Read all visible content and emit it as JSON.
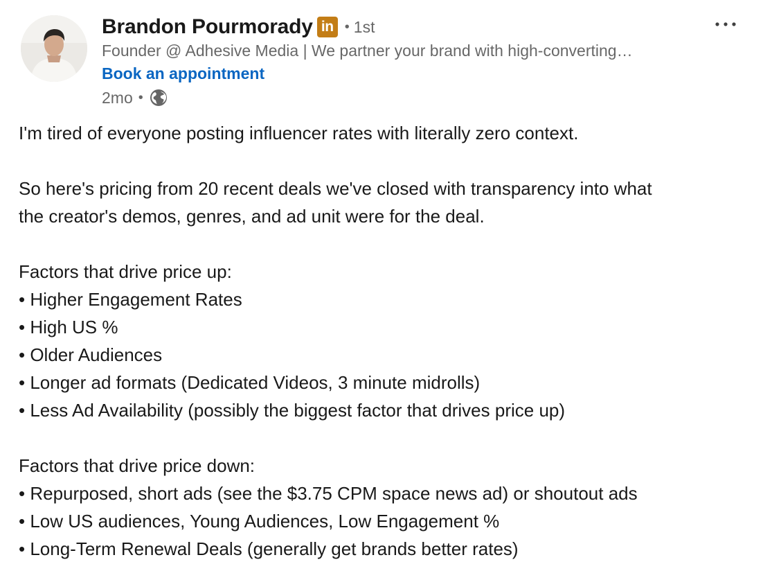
{
  "post": {
    "author": {
      "name": "Brandon Pourmorady",
      "badge": "in",
      "connection_separator": "•",
      "connection_degree": "1st",
      "headline": "Founder @ Adhesive Media | We partner your brand with high-converting…",
      "cta_label": "Book an appointment",
      "time_ago": "2mo",
      "meta_separator": "•",
      "visibility_icon": "globe-icon",
      "avatar_icon": "profile-photo"
    },
    "more_menu_icon": "ellipsis-icon",
    "colors": {
      "accent": "#0a66c2",
      "badge": "#c37d16",
      "secondary_text": "#666666",
      "primary_text": "#191919"
    },
    "body": {
      "intro": "I'm tired of everyone posting influencer rates with literally zero context.",
      "para2_line1": "So here's pricing from 20 recent deals we've closed with transparency into what",
      "para2_line2": "the creator's demos, genres, and ad unit were for the deal.",
      "up_heading": "Factors that drive price up:",
      "up_items": [
        "• Higher Engagement Rates",
        "• High US %",
        "• Older Audiences",
        "• Longer ad formats (Dedicated Videos, 3 minute midrolls)",
        "• Less Ad Availability (possibly the biggest factor that drives price up)"
      ],
      "down_heading": "Factors that drive price down:",
      "down_items": [
        "• Repurposed, short ads (see the $3.75 CPM space news ad) or shoutout ads",
        "• Low US audiences, Young Audiences, Low Engagement %",
        "• Long-Term Renewal Deals (generally get brands better rates)"
      ]
    }
  }
}
